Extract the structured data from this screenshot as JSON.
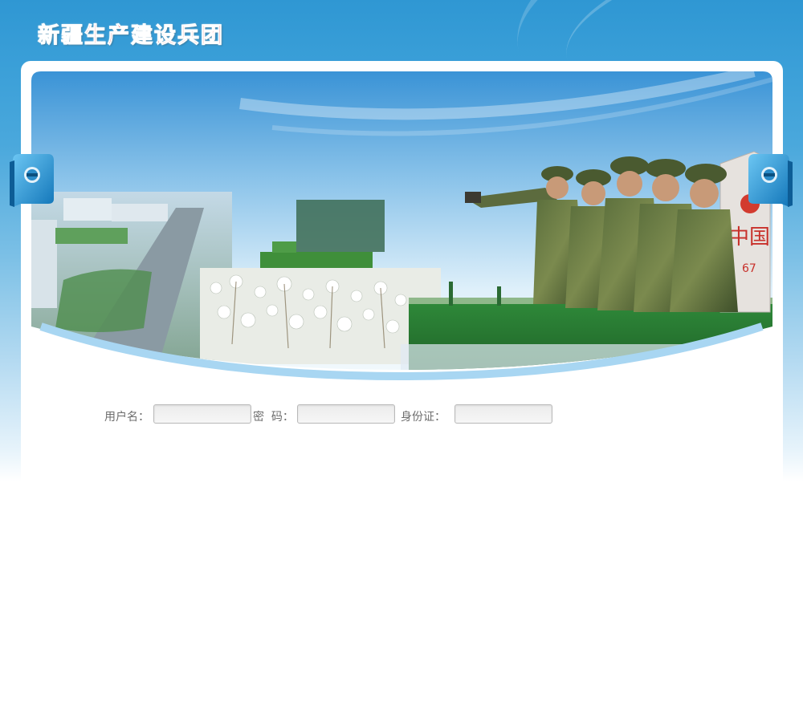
{
  "header": {
    "title": "新疆生产建设兵团"
  },
  "banner": {
    "sign_text": "中国",
    "sign_sub": "67"
  },
  "login": {
    "username_label": "用户名：",
    "username_value": "",
    "password_label": "密  码：",
    "password_value": "",
    "idcard_label": "身份证：",
    "idcard_value": ""
  },
  "colors": {
    "sky_top": "#2f97d3",
    "title_red": "#e01414",
    "label_gray": "#6d6d6d",
    "banner_arc": "#a8d6f2"
  }
}
